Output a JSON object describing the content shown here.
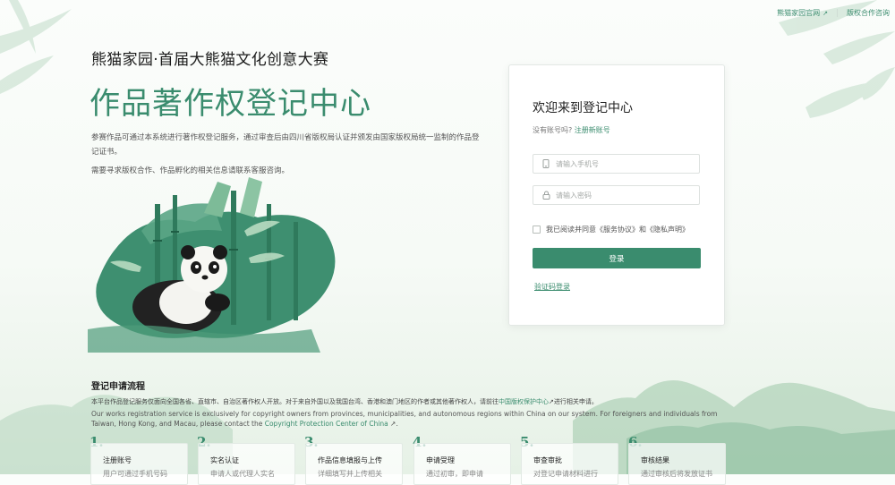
{
  "topnav": {
    "links": [
      {
        "label": "熊猫家园官网"
      },
      {
        "label": "版权合作咨询"
      }
    ]
  },
  "hero": {
    "subtitle": "熊猫家园·首届大熊猫文化创意大赛",
    "title": "作品著作权登记中心",
    "description": "参赛作品可通过本系统进行著作权登记服务，通过审查后由四川省版权局认证并颁发由国家版权局统一监制的作品登记证书。",
    "note": "需要寻求版权合作、作品孵化的相关信息请联系客服咨询。"
  },
  "login": {
    "welcome": "欢迎来到登记中心",
    "no_account_text": "没有账号吗?",
    "register_link": "注册新账号",
    "phone_placeholder": "请输入手机号",
    "password_placeholder": "请输入密码",
    "agree_text": "我已阅读并同意《服务协议》和《隐私声明》",
    "login_button": "登录",
    "sms_login": "验证码登录"
  },
  "process": {
    "title": "登记申请流程",
    "intro_cn_before": "本平台作品登记服务仅面向全国各省、直辖市、自治区著作权人开放。对于来自外国以及我国台湾、香港和澳门地区的作者或其他著作权人，请前往",
    "intro_cn_link": "中国版权保护中心",
    "intro_cn_after": "进行相关申请。",
    "intro_en_before": "Our works registration service is exclusively for copyright owners from provinces, municipalities, and autonomous regions within China on our system. For foreigners and individuals from Taiwan, Hong Kong, and Macau, please contact the",
    "intro_en_link": "Copyright Protection Center of China",
    "intro_en_after": ".",
    "steps": [
      {
        "num": "1.",
        "title": "注册账号",
        "desc": "用户可通过手机号码"
      },
      {
        "num": "2.",
        "title": "实名认证",
        "desc": "申请人或代理人实名"
      },
      {
        "num": "3.",
        "title": "作品信息填报与上传",
        "desc": "详细填写并上传相关"
      },
      {
        "num": "4.",
        "title": "申请受理",
        "desc": "通过初审，即申请"
      },
      {
        "num": "5.",
        "title": "审查审批",
        "desc": "对登记申请材料进行"
      },
      {
        "num": "6.",
        "title": "审核结果",
        "desc": "通过审核后将发放证书"
      }
    ]
  },
  "colors": {
    "accent": "#3a8c6e"
  }
}
